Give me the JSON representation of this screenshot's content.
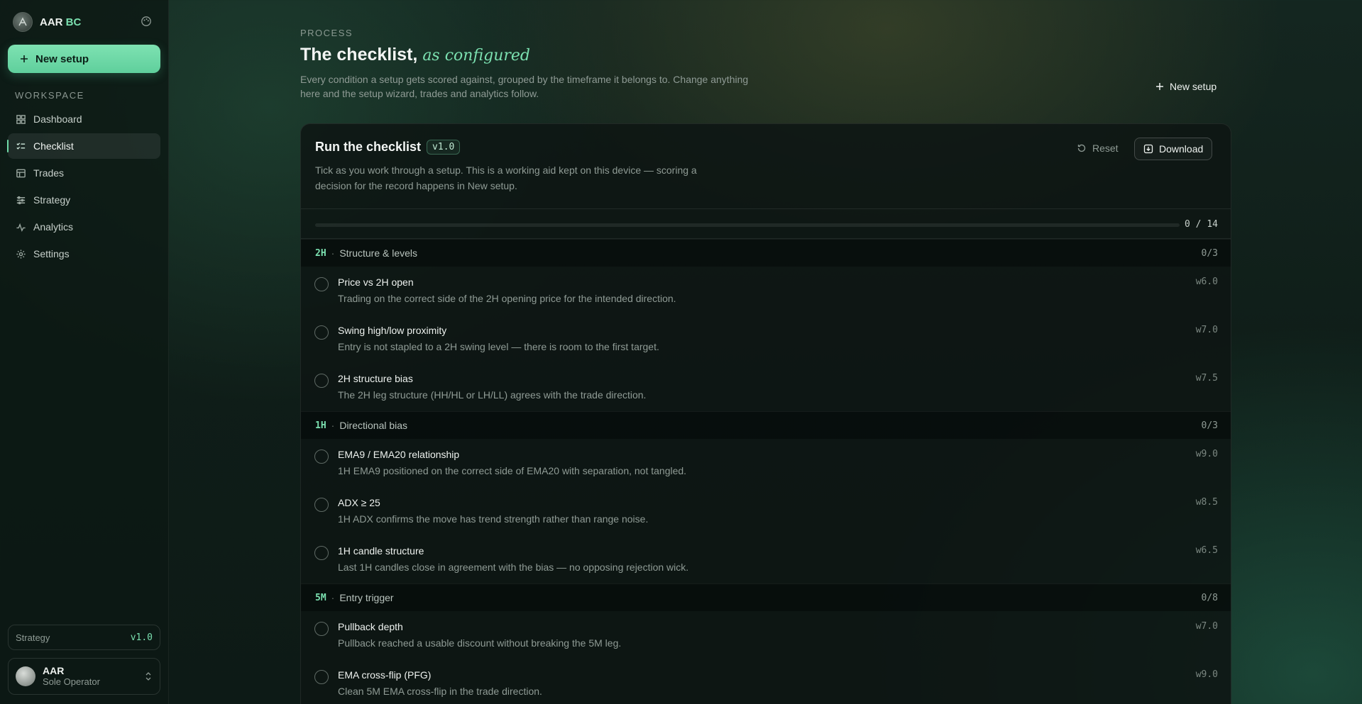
{
  "brand": {
    "name": "AAR",
    "accent": "BC"
  },
  "sidebar": {
    "new_setup_label": "New setup",
    "section_label": "WORKSPACE",
    "items": [
      {
        "label": "Dashboard",
        "icon": "grid-icon"
      },
      {
        "label": "Checklist",
        "icon": "list-check-icon",
        "active": true
      },
      {
        "label": "Trades",
        "icon": "table-icon"
      },
      {
        "label": "Strategy",
        "icon": "sliders-icon"
      },
      {
        "label": "Analytics",
        "icon": "activity-icon"
      },
      {
        "label": "Settings",
        "icon": "gear-icon"
      }
    ],
    "strategy": {
      "label": "Strategy",
      "version": "v1.0"
    },
    "user": {
      "name": "AAR",
      "role": "Sole Operator"
    }
  },
  "header": {
    "eyebrow": "PROCESS",
    "title": "The checklist,",
    "title_italic": "as configured",
    "description": "Every condition a setup gets scored against, grouped by the timeframe it belongs to. Change anything here and the setup wizard, trades and analytics follow.",
    "new_setup_label": "New setup"
  },
  "card": {
    "title": "Run the checklist",
    "version": "v1.0",
    "description": "Tick as you work through a setup. This is a working aid kept on this device — scoring a decision for the record happens in New setup.",
    "reset_label": "Reset",
    "download_label": "Download",
    "progress": {
      "done": 0,
      "total": 14,
      "text": "0 / 14"
    }
  },
  "groups": [
    {
      "timeframe": "2H",
      "name": "Structure & levels",
      "count": "0/3",
      "items": [
        {
          "name": "Price vs 2H open",
          "desc": "Trading on the correct side of the 2H opening price for the intended direction.",
          "weight": "w6.0"
        },
        {
          "name": "Swing high/low proximity",
          "desc": "Entry is not stapled to a 2H swing level — there is room to the first target.",
          "weight": "w7.0"
        },
        {
          "name": "2H structure bias",
          "desc": "The 2H leg structure (HH/HL or LH/LL) agrees with the trade direction.",
          "weight": "w7.5"
        }
      ]
    },
    {
      "timeframe": "1H",
      "name": "Directional bias",
      "count": "0/3",
      "items": [
        {
          "name": "EMA9 / EMA20 relationship",
          "desc": "1H EMA9 positioned on the correct side of EMA20 with separation, not tangled.",
          "weight": "w9.0"
        },
        {
          "name": "ADX ≥ 25",
          "desc": "1H ADX confirms the move has trend strength rather than range noise.",
          "weight": "w8.5"
        },
        {
          "name": "1H candle structure",
          "desc": "Last 1H candles close in agreement with the bias — no opposing rejection wick.",
          "weight": "w6.5"
        }
      ]
    },
    {
      "timeframe": "5M",
      "name": "Entry trigger",
      "count": "0/8",
      "items": [
        {
          "name": "Pullback depth",
          "desc": "Pullback reached a usable discount without breaking the 5M leg.",
          "weight": "w7.0"
        },
        {
          "name": "EMA cross-flip (PFG)",
          "desc": "Clean 5M EMA cross-flip in the trade direction.",
          "weight": "w9.0"
        }
      ]
    }
  ]
}
